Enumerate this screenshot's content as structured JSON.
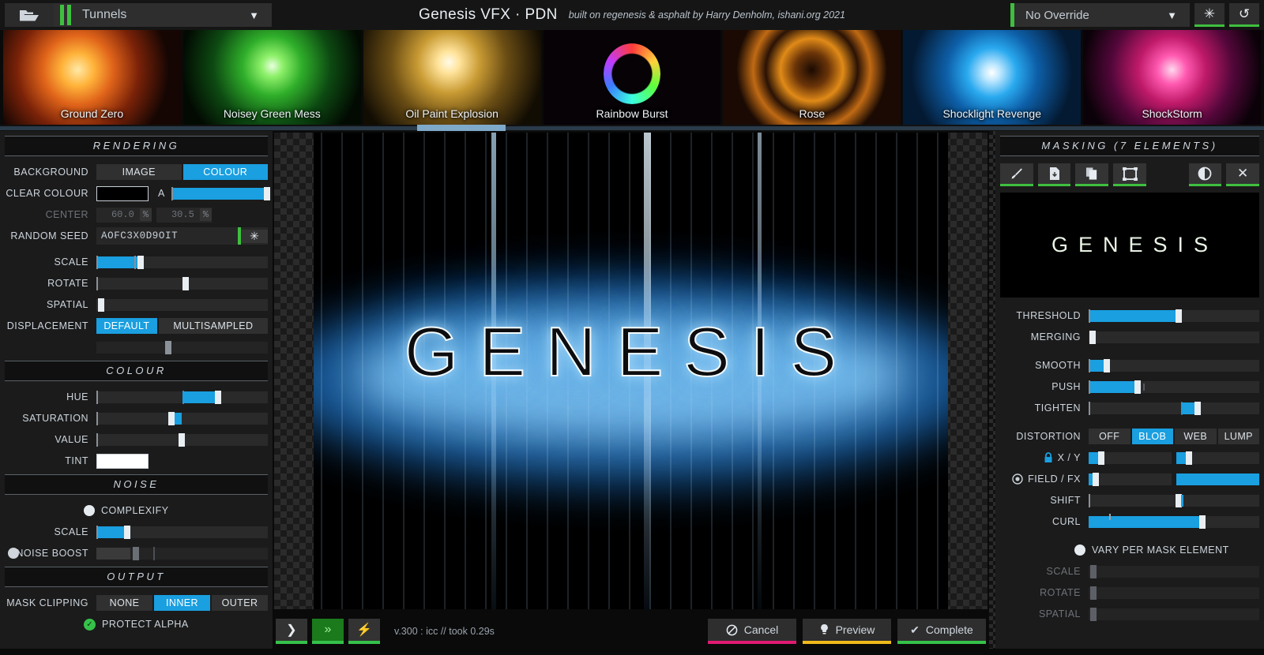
{
  "topbar": {
    "folder_icon": "folder-open-icon",
    "preset_name": "Tunnels",
    "chevron": "▼",
    "app_title": "Genesis VFX · PDN",
    "app_subtitle": "built on regenesis & asphalt by Harry Denholm, ishani.org 2021",
    "override_label": "No Override",
    "randomize_icon": "✳",
    "reset_icon": "↺"
  },
  "presets": [
    {
      "label": "Ground Zero",
      "selected": false
    },
    {
      "label": "Noisey Green Mess",
      "selected": false
    },
    {
      "label": "Oil Paint Explosion",
      "selected": false
    },
    {
      "label": "Rainbow Burst",
      "selected": false
    },
    {
      "label": "Rose",
      "selected": false
    },
    {
      "label": "Shocklight Revenge",
      "selected": true
    },
    {
      "label": "ShockStorm",
      "selected": false
    }
  ],
  "left_panel": {
    "rendering": {
      "title": "RENDERING",
      "background": {
        "label": "BACKGROUND",
        "options": [
          "IMAGE",
          "COLOUR"
        ],
        "selected": "COLOUR"
      },
      "clear_colour": {
        "label": "CLEAR COLOUR",
        "swatch": "#000000",
        "alpha_label": "A",
        "alpha_pct": 96
      },
      "center": {
        "label": "CENTER",
        "x": "60.0",
        "x_unit": "%",
        "y": "30.5",
        "y_unit": "%",
        "disabled": true
      },
      "random_seed": {
        "label": "RANDOM SEED",
        "value": "AOFC3X0D9OIT",
        "dice_icon": "✳"
      },
      "scale": {
        "label": "SCALE",
        "pct": 24,
        "tick": 22
      },
      "rotate": {
        "label": "ROTATE",
        "pct": 50
      },
      "spatial": {
        "label": "SPATIAL",
        "pct": 2
      },
      "displacement": {
        "label": "DISPLACEMENT",
        "options": [
          "DEFAULT",
          "MULTISAMPLED"
        ],
        "selected": "DEFAULT"
      },
      "displacement_amount": {
        "pct": 40
      }
    },
    "colour": {
      "title": "COLOUR",
      "hue": {
        "label": "HUE",
        "start": 50,
        "end": 70,
        "tick": 50
      },
      "saturation": {
        "label": "SATURATION",
        "start": 42,
        "end": 48
      },
      "value": {
        "label": "VALUE",
        "pct": 48
      },
      "tint": {
        "label": "TINT",
        "swatch": "#ffffff"
      }
    },
    "noise": {
      "title": "NOISE",
      "complexify": {
        "label": "COMPLEXIFY",
        "on": false
      },
      "scale": {
        "label": "SCALE",
        "pct": 16
      },
      "noise_boost": {
        "label": "NOISE BOOST",
        "pct": 22,
        "disabled": true
      }
    },
    "output": {
      "title": "OUTPUT",
      "mask_clipping": {
        "label": "MASK CLIPPING",
        "options": [
          "NONE",
          "INNER",
          "OUTER"
        ],
        "selected": "INNER"
      },
      "protect_alpha": {
        "label": "PROTECT ALPHA",
        "checked": true
      }
    }
  },
  "canvas": {
    "text": "GENESIS"
  },
  "bottombar": {
    "step_icon": "❯",
    "fastforward_icon": "»",
    "bolt_icon": "⚡",
    "status": "v.300 : icc // took 0.29s",
    "cancel": {
      "label": "Cancel",
      "icon": "⃠"
    },
    "preview": {
      "label": "Preview",
      "icon": "Ὂ1"
    },
    "complete": {
      "label": "Complete",
      "icon": "✔"
    }
  },
  "right_panel": {
    "title": "MASKING (7 ELEMENTS)",
    "tools": [
      {
        "name": "brush-icon",
        "glyph": "✎"
      },
      {
        "name": "save-file-icon",
        "glyph": "⬇"
      },
      {
        "name": "copy-icon",
        "glyph": "⧉"
      },
      {
        "name": "transform-frame-icon",
        "glyph": "⛶"
      },
      {
        "name": "contrast-icon",
        "glyph": "◐"
      },
      {
        "name": "close-icon",
        "glyph": "✕"
      }
    ],
    "preview_text": "GENESIS",
    "threshold": {
      "label": "THRESHOLD",
      "pct": 52
    },
    "merging": {
      "label": "MERGING",
      "pct": 1
    },
    "smooth": {
      "label": "SMOOTH",
      "pct": 10
    },
    "push": {
      "label": "PUSH",
      "pct": 28,
      "tick": 32
    },
    "tighten": {
      "label": "TIGHTEN",
      "pct": 62
    },
    "distortion": {
      "label": "DISTORTION",
      "options": [
        "OFF",
        "BLOB",
        "WEB",
        "LUMP"
      ],
      "selected": "BLOB"
    },
    "xy": {
      "label": "X / Y",
      "icon": "lock-icon",
      "left_pct": 12,
      "right_pct": 12
    },
    "field_fx": {
      "label": "FIELD / FX",
      "icon": "target-icon",
      "left_pct": 6,
      "right_pct": 100
    },
    "shift": {
      "label": "SHIFT",
      "pct": 53
    },
    "curl": {
      "label": "CURL",
      "pct": 66,
      "tick": 12
    },
    "vary_per_mask_element": {
      "label": "VARY PER MASK ELEMENT",
      "on": false
    },
    "scale": {
      "label": "SCALE",
      "pct": 2,
      "disabled": true
    },
    "rotate": {
      "label": "ROTATE",
      "pct": 2,
      "disabled": true
    },
    "spatial": {
      "label": "SPATIAL",
      "pct": 2,
      "disabled": true
    }
  }
}
